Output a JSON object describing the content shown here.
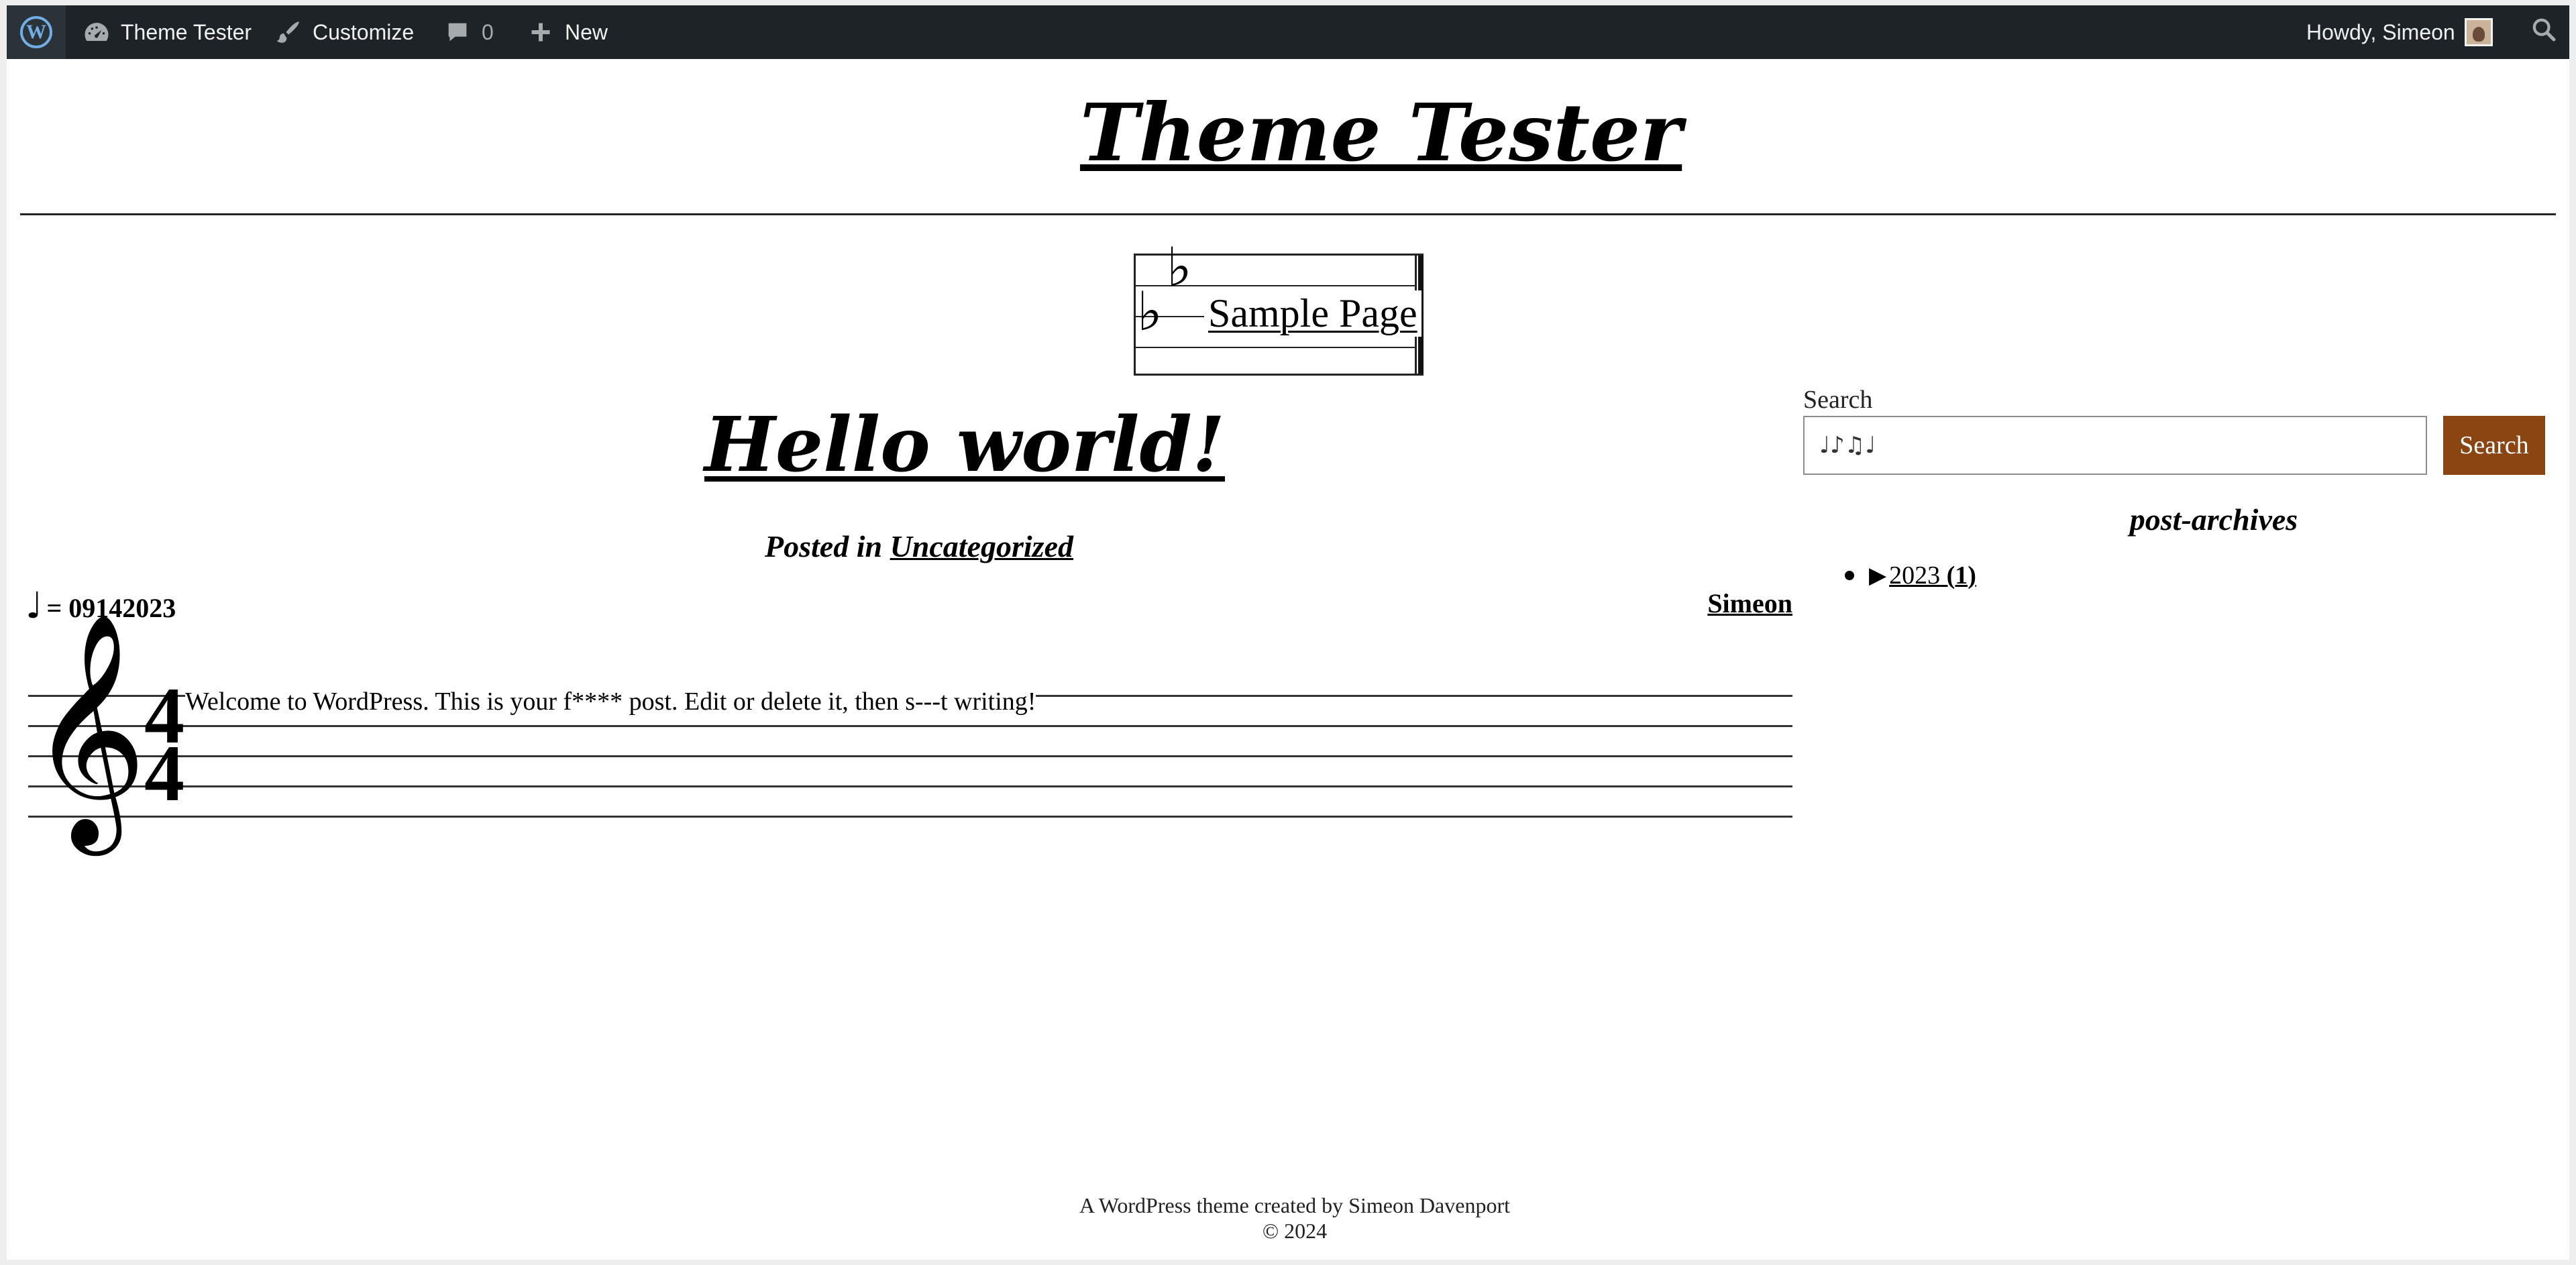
{
  "admin_bar": {
    "site_name": "Theme Tester",
    "customize": "Customize",
    "comments_count": "0",
    "new": "New",
    "howdy": "Howdy, Simeon"
  },
  "header": {
    "site_title": "Theme Tester"
  },
  "nav": {
    "items": [
      {
        "label": "Sample Page"
      }
    ],
    "flat_symbol": "♭"
  },
  "post": {
    "title": "Hello world!",
    "posted_in_prefix": "Posted in ",
    "category": "Uncategorized",
    "tempo_note": "♩",
    "date": "= 09142023",
    "author": "Simeon",
    "clef_symbol": "𝄞",
    "time_signature_top": "4",
    "time_signature_bottom": "4",
    "body": "Welcome to WordPress. This is your f**** post. Edit or delete it, then s---t writing!"
  },
  "sidebar": {
    "search_label": "Search",
    "search_placeholder": "♩♪♫♩",
    "search_button": "Search",
    "archives_title": "post-archives",
    "archives": [
      {
        "toggle": "▶",
        "year": "2023",
        "count": "(1)"
      }
    ]
  },
  "footer": {
    "credit": "A WordPress theme created by Simeon Davenport",
    "copyright": "© 2024"
  },
  "colors": {
    "admin_bar_bg": "#1d2327",
    "admin_bar_text": "#f0f0f1",
    "wp_logo": "#72aee6",
    "search_button_bg": "#8b4513"
  },
  "icons": {
    "wp_logo": "wordpress-logo-icon",
    "site": "dashboard-gauge-icon",
    "customize": "paintbrush-icon",
    "comments": "speech-bubble-icon",
    "new": "plus-icon",
    "search": "search-icon",
    "avatar": "user-avatar-icon"
  }
}
